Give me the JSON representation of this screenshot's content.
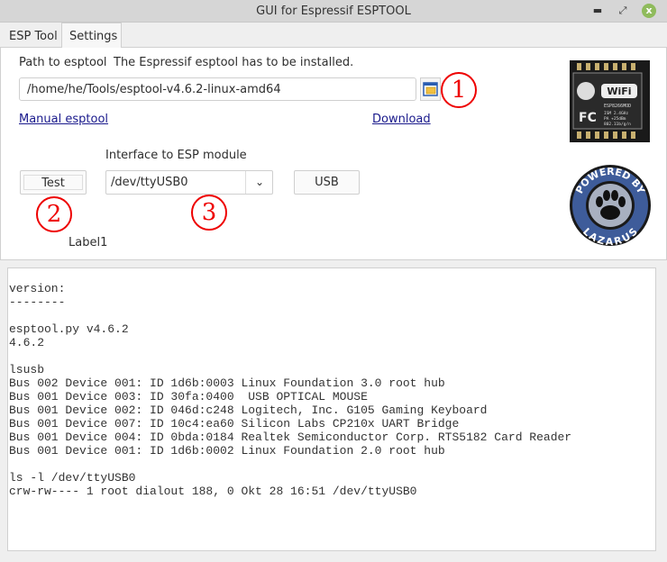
{
  "window": {
    "title": "GUI for Espressif ESPTOOL",
    "minimize": "▬",
    "maximize": "⤢",
    "close": "x"
  },
  "tabs": [
    {
      "label": "ESP Tool",
      "active": false
    },
    {
      "label": "Settings",
      "active": true
    }
  ],
  "settings": {
    "path_label": "Path to esptool",
    "path_hint": "The Espressif esptool has to be installed.",
    "path_value": "/home/he/Tools/esptool-v4.6.2-linux-amd64",
    "manual_link": "Manual esptool",
    "download_link": "Download",
    "interface_label": "Interface to ESP module",
    "test_button": "Test",
    "interface_value": "/dev/ttyUSB0",
    "usb_button": "USB",
    "label1": "Label1",
    "markers": [
      "1",
      "2",
      "3"
    ],
    "esp_module_image": {
      "wifi": "WiFi",
      "model": "ESP8266MOD",
      "specs": [
        "ISM 2.4GHz",
        "PA +25dBm",
        "802.11b/g/n"
      ]
    },
    "lazarus_logo": {
      "top": "POWERED BY",
      "bottom": "LAZARUS"
    }
  },
  "log": {
    "lines": [
      "version:",
      "--------",
      "",
      "esptool.py v4.6.2",
      "4.6.2",
      "",
      "lsusb",
      "Bus 002 Device 001: ID 1d6b:0003 Linux Foundation 3.0 root hub",
      "Bus 001 Device 003: ID 30fa:0400  USB OPTICAL MOUSE",
      "Bus 001 Device 002: ID 046d:c248 Logitech, Inc. G105 Gaming Keyboard",
      "Bus 001 Device 007: ID 10c4:ea60 Silicon Labs CP210x UART Bridge",
      "Bus 001 Device 004: ID 0bda:0184 Realtek Semiconductor Corp. RTS5182 Card Reader",
      "Bus 001 Device 001: ID 1d6b:0002 Linux Foundation 2.0 root hub",
      "",
      "ls -l /dev/ttyUSB0",
      "crw-rw---- 1 root dialout 188, 0 Okt 28 16:51 /dev/ttyUSB0"
    ]
  },
  "colors": {
    "marker": "#e00000",
    "link": "#1a1a8c",
    "close": "#8fbb5c"
  }
}
